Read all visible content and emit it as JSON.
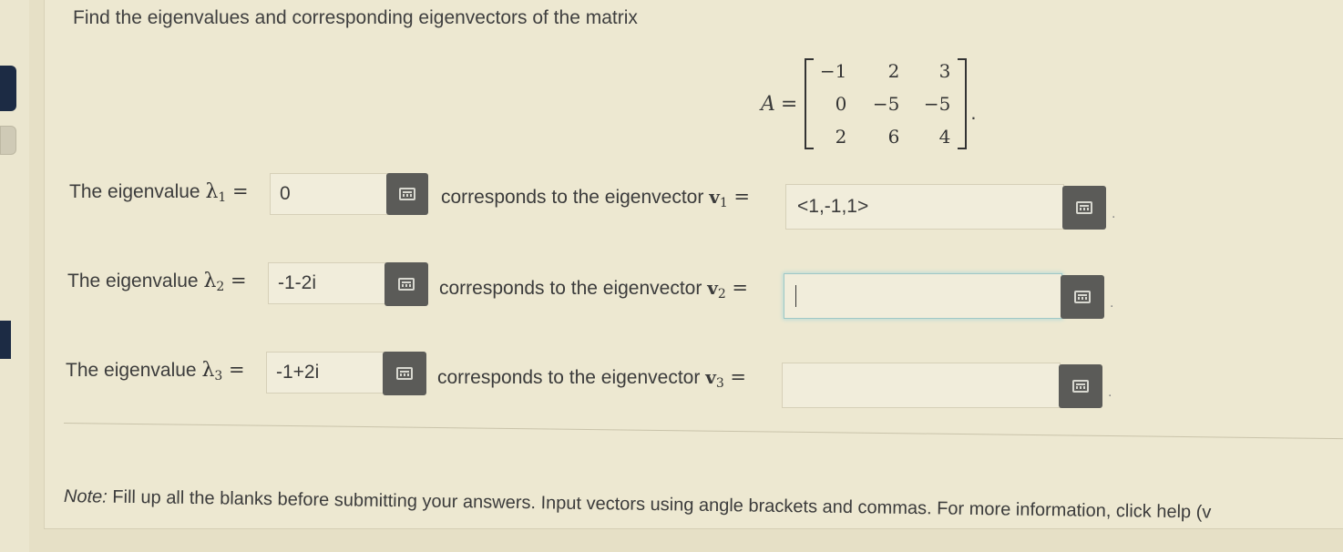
{
  "question": "Find the eigenvalues and corresponding eigenvectors of the matrix",
  "matrix": {
    "label": "A",
    "equals": "=",
    "rows": [
      [
        "−1",
        "2",
        "3"
      ],
      [
        "0",
        "−5",
        "−5"
      ],
      [
        "2",
        "6",
        "4"
      ]
    ],
    "trailing": "."
  },
  "rows": [
    {
      "label_prefix": "The eigenvalue ",
      "lambda": "λ",
      "sub": "1",
      "equals": " =",
      "eigenvalue": "0",
      "middle_prefix": "corresponds to the eigenvector ",
      "v": "v",
      "v_sub": "1",
      "v_equals": " =",
      "eigenvector": "<1,-1,1>"
    },
    {
      "label_prefix": "The eigenvalue ",
      "lambda": "λ",
      "sub": "2",
      "equals": " =",
      "eigenvalue": "-1-2i",
      "middle_prefix": "corresponds to the eigenvector ",
      "v": "v",
      "v_sub": "2",
      "v_equals": " =",
      "eigenvector": ""
    },
    {
      "label_prefix": "The eigenvalue ",
      "lambda": "λ",
      "sub": "3",
      "equals": " =",
      "eigenvalue": "-1+2i",
      "middle_prefix": "corresponds to the eigenvector ",
      "v": "v",
      "v_sub": "3",
      "v_equals": " =",
      "eigenvector": ""
    }
  ],
  "note": {
    "label": "Note:",
    "text": " Fill up all the blanks before submitting your answers. Input vectors using angle brackets and commas. For more information, click help (v"
  },
  "icons": {
    "calculator": "calculator-icon"
  },
  "colors": {
    "background": "#e6e0c6",
    "button": "#5b5b58",
    "focus": "#9fc7c6"
  }
}
